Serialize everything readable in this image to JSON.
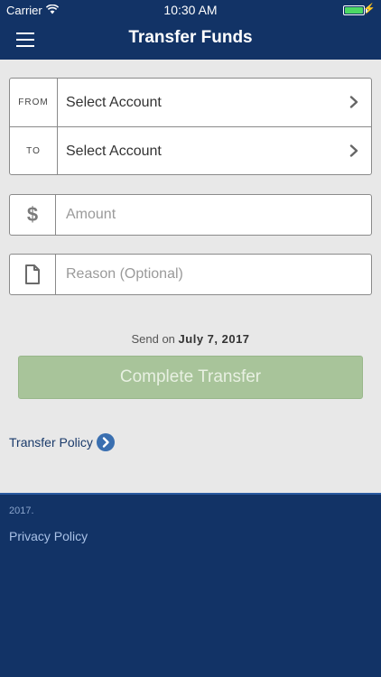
{
  "status_bar": {
    "carrier": "Carrier",
    "time": "10:30 AM",
    "battery_level": 1.0
  },
  "nav": {
    "title": "Transfer Funds",
    "menu_icon": "hamburger-menu-icon"
  },
  "accounts": {
    "from_label": "FROM",
    "from_value": "Select Account",
    "to_label": "TO",
    "to_value": "Select Account"
  },
  "amount": {
    "icon_glyph": "$",
    "placeholder": "Amount"
  },
  "reason": {
    "icon": "document-icon",
    "placeholder": "Reason (Optional)"
  },
  "send_on": {
    "prefix": "Send on",
    "date": "July 7, 2017"
  },
  "complete_button": {
    "label": "Complete Transfer"
  },
  "policy": {
    "label": "Transfer Policy"
  },
  "footer": {
    "year_text": "2017.",
    "privacy_label": "Privacy Policy"
  },
  "colors": {
    "nav_bg": "#123366",
    "page_bg": "#e8e8e8",
    "button_disabled": "#a8c49a",
    "link": "#1a3a6a",
    "policy_arrow": "#3a6fb0",
    "battery": "#4cd964"
  }
}
